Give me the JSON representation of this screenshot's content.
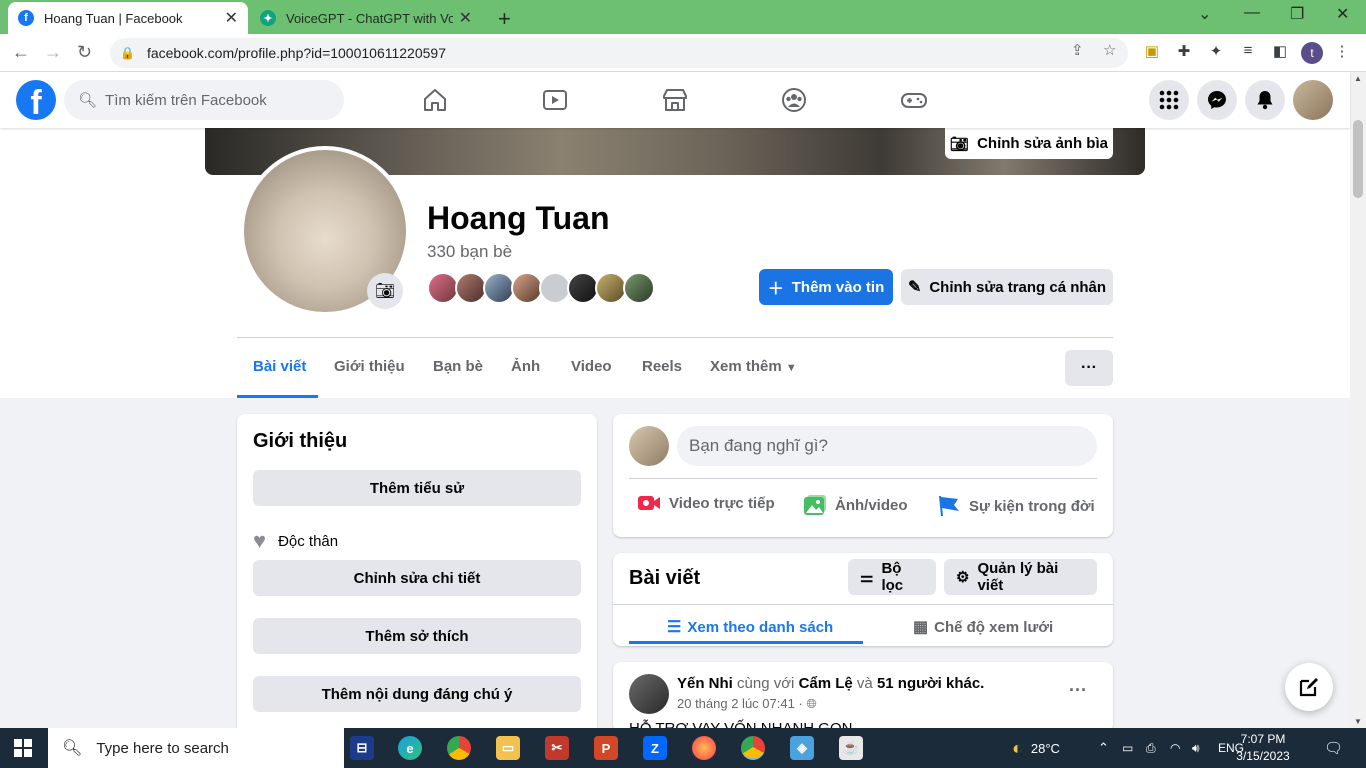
{
  "browser": {
    "tabs": [
      {
        "title": "Hoang Tuan | Facebook",
        "favicon": "f"
      },
      {
        "title": "VoiceGPT - ChatGPT with Voice",
        "favicon": "✦"
      }
    ],
    "close_glyph": "✕",
    "newtab_glyph": "+",
    "url": "facebook.com/profile.php?id=100010611220597",
    "profile_initial": "t",
    "window_controls": [
      "⌄",
      "—",
      "❐",
      "✕"
    ]
  },
  "fb": {
    "logo": "f",
    "search_placeholder": "Tìm kiếm trên Facebook"
  },
  "profile": {
    "cover_button": "Chỉnh sửa ảnh bìa",
    "name": "Hoang Tuan",
    "friends_count": "330 bạn bè",
    "add_story": "Thêm vào tin",
    "edit_profile": "Chỉnh sửa trang cá nhân",
    "tabs": [
      "Bài viết",
      "Giới thiệu",
      "Bạn bè",
      "Ảnh",
      "Video",
      "Reels",
      "Xem thêm"
    ],
    "more_dots": "···"
  },
  "intro": {
    "title": "Giới thiệu",
    "add_bio": "Thêm tiểu sử",
    "relationship": "Độc thân",
    "edit_details": "Chỉnh sửa chi tiết",
    "add_hobbies": "Thêm sở thích",
    "add_featured": "Thêm nội dung đáng chú ý"
  },
  "composer": {
    "placeholder": "Bạn đang nghĩ gì?",
    "live_video": "Video trực tiếp",
    "photo_video": "Ảnh/video",
    "life_event": "Sự kiện trong đời"
  },
  "posts": {
    "title": "Bài viết",
    "filter": "Bộ lọc",
    "manage": "Quản lý bài viết",
    "list_view": "Xem theo danh sách",
    "grid_view": "Chế độ xem lưới"
  },
  "post": {
    "author": "Yến Nhi",
    "with_text": "cùng với",
    "tagged": "Cẩm Lệ",
    "and_text": "và",
    "others": "51 người khác.",
    "time": "20 tháng 2 lúc 07:41 · ",
    "text": "HỖ TRỢ VAY VỐN NHANH GỌN",
    "dots": "···"
  },
  "taskbar": {
    "search": "Type here to search",
    "weather": "28°C",
    "lang": "ENG",
    "time": "7:07 PM",
    "date": "3/15/2023"
  },
  "colors": {
    "fb_blue": "#1877f2",
    "tab_bar_green": "#6dbf72",
    "taskbar": "#1c2b3a"
  }
}
